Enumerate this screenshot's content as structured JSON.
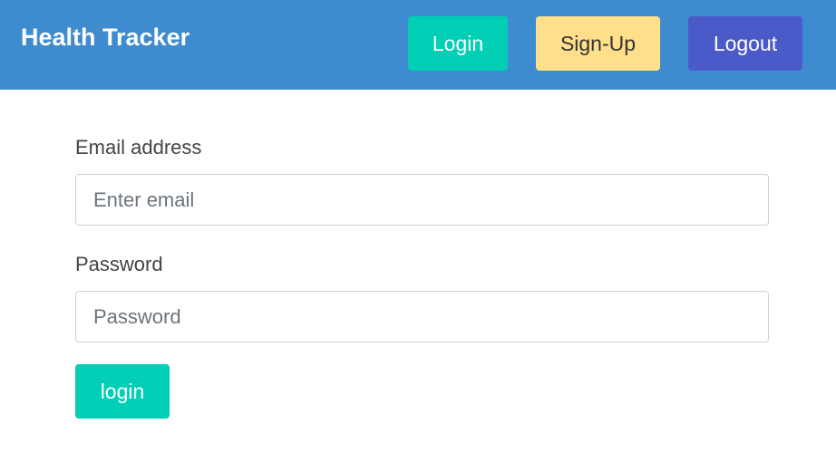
{
  "navbar": {
    "brand": "Health Tracker",
    "buttons": {
      "login": "Login",
      "signup": "Sign-Up",
      "logout": "Logout"
    }
  },
  "form": {
    "email": {
      "label": "Email address",
      "placeholder": "Enter email",
      "value": ""
    },
    "password": {
      "label": "Password",
      "placeholder": "Password",
      "value": ""
    },
    "submit_label": "login"
  },
  "colors": {
    "navbar_bg": "#3e8ccf",
    "teal": "#00cfb5",
    "yellow": "#ffdf89",
    "indigo": "#4a5bc9"
  }
}
